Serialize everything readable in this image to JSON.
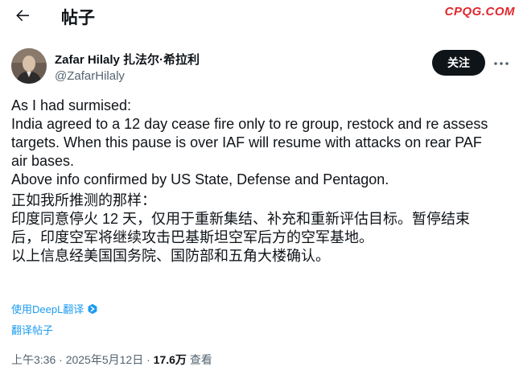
{
  "header": {
    "title": "帖子",
    "watermark": "CPQG.COM"
  },
  "author": {
    "name": "Zafar Hilaly 扎法尔·希拉利",
    "handle": "@ZafarHilaly",
    "follow_label": "关注"
  },
  "tweet": {
    "lines": [
      "As I had surmised:",
      "India agreed to a 12 day cease fire only to re group, restock and re assess",
      "targets. When this pause is over IAF will resume with attacks on rear PAF",
      "air bases.",
      "Above info confirmed by US State, Defense and Pentagon.",
      "正如我所推测的那样：",
      "印度同意停火 12 天，仅用于重新集结、补充和重新评估目标。暂停结束",
      "后，印度空军将继续攻击巴基斯坦空军后方的空军基地。",
      "以上信息经美国国务院、国防部和五角大楼确认。"
    ]
  },
  "translation": {
    "deepl_label": "使用DeepL翻译",
    "translate_post_label": "翻译帖子"
  },
  "meta": {
    "time": "上午3:36",
    "separator": "·",
    "date": "2025年5月12日",
    "views": "17.6万",
    "views_label": "查看"
  },
  "icons": {
    "back": "arrow-left-icon",
    "more": "more-horizontal-icon",
    "deepl": "deepl-icon"
  },
  "colors": {
    "link": "#1d9bf0",
    "secondary_text": "#536471",
    "follow_button_bg": "#0f1419",
    "watermark": "#e0282e"
  }
}
